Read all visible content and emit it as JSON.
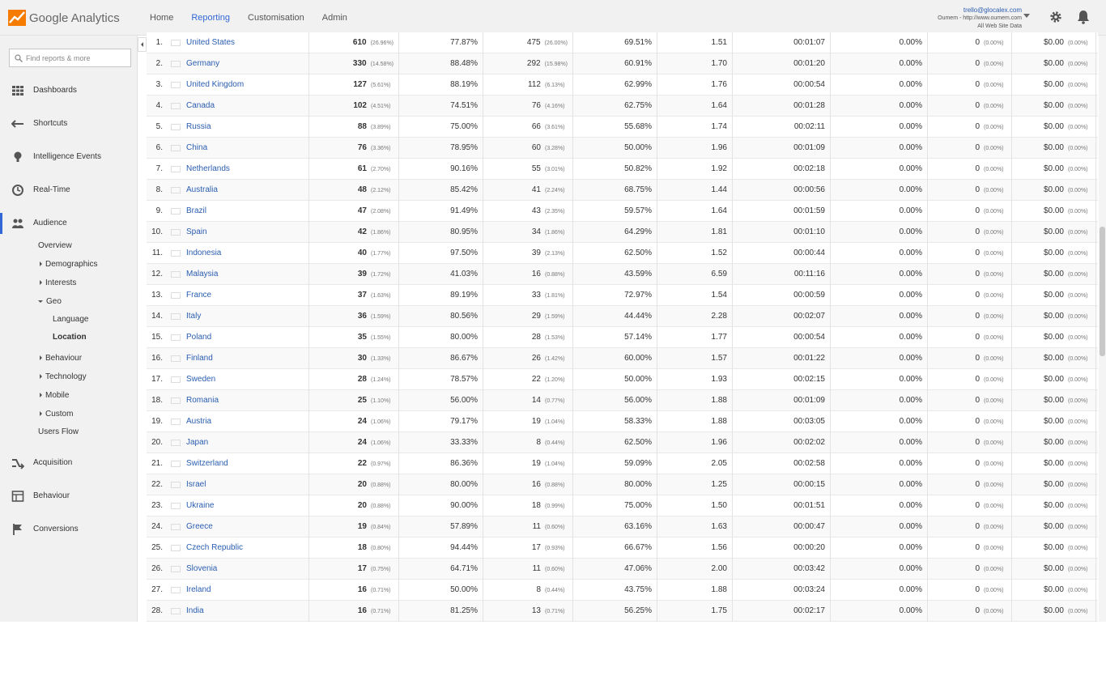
{
  "app": {
    "logo_google": "Google",
    "logo_product": "Analytics"
  },
  "topnav": [
    {
      "label": "Home",
      "active": false
    },
    {
      "label": "Reporting",
      "active": true
    },
    {
      "label": "Customisation",
      "active": false
    },
    {
      "label": "Admin",
      "active": false
    }
  ],
  "account": {
    "email": "trello@glocalex.com",
    "property": "Oumem - http://www.oumem.com",
    "view": "All Web Site Data"
  },
  "sidebar": {
    "search_placeholder": "Find reports & more",
    "main": [
      {
        "label": "Dashboards",
        "icon": "dashboards-icon"
      },
      {
        "label": "Shortcuts",
        "icon": "shortcuts-icon"
      },
      {
        "label": "Intelligence Events",
        "icon": "lightbulb-icon"
      },
      {
        "label": "Real-Time",
        "icon": "clock-icon"
      },
      {
        "label": "Audience",
        "icon": "people-icon",
        "active": true
      },
      {
        "label": "Acquisition",
        "icon": "acquisition-icon"
      },
      {
        "label": "Behaviour",
        "icon": "behaviour-icon"
      },
      {
        "label": "Conversions",
        "icon": "flag-icon"
      }
    ],
    "audience_sub": [
      {
        "label": "Overview",
        "level": 1,
        "caret": "none"
      },
      {
        "label": "Demographics",
        "level": 1,
        "caret": "right"
      },
      {
        "label": "Interests",
        "level": 1,
        "caret": "right"
      },
      {
        "label": "Geo",
        "level": 1,
        "caret": "down"
      },
      {
        "label": "Language",
        "level": 2,
        "caret": "none"
      },
      {
        "label": "Location",
        "level": 2,
        "caret": "none",
        "selected": true
      },
      {
        "label": "Behaviour",
        "level": 1,
        "caret": "right"
      },
      {
        "label": "Technology",
        "level": 1,
        "caret": "right"
      },
      {
        "label": "Mobile",
        "level": 1,
        "caret": "right"
      },
      {
        "label": "Custom",
        "level": 1,
        "caret": "right"
      },
      {
        "label": "Users Flow",
        "level": 1,
        "caret": "none"
      }
    ]
  },
  "table": {
    "rows": [
      {
        "idx": "1.",
        "country": "United States",
        "flag": "us",
        "sessions": "610",
        "sessions_pct": "(26.96%)",
        "new_sessions": "77.87%",
        "new_users": "475",
        "new_users_pct": "(26.00%)",
        "bounce": "69.51%",
        "pages": "1.51",
        "duration": "00:01:07",
        "conv": "0.00%",
        "goal": "0",
        "goal_pct": "(0.00%)",
        "value": "$0.00",
        "value_pct": "(0.00%)"
      },
      {
        "idx": "2.",
        "country": "Germany",
        "flag": "de",
        "sessions": "330",
        "sessions_pct": "(14.58%)",
        "new_sessions": "88.48%",
        "new_users": "292",
        "new_users_pct": "(15.98%)",
        "bounce": "60.91%",
        "pages": "1.70",
        "duration": "00:01:20",
        "conv": "0.00%",
        "goal": "0",
        "goal_pct": "(0.00%)",
        "value": "$0.00",
        "value_pct": "(0.00%)"
      },
      {
        "idx": "3.",
        "country": "United Kingdom",
        "flag": "gb",
        "sessions": "127",
        "sessions_pct": "(5.61%)",
        "new_sessions": "88.19%",
        "new_users": "112",
        "new_users_pct": "(6.13%)",
        "bounce": "62.99%",
        "pages": "1.76",
        "duration": "00:00:54",
        "conv": "0.00%",
        "goal": "0",
        "goal_pct": "(0.00%)",
        "value": "$0.00",
        "value_pct": "(0.00%)"
      },
      {
        "idx": "4.",
        "country": "Canada",
        "flag": "ca",
        "sessions": "102",
        "sessions_pct": "(4.51%)",
        "new_sessions": "74.51%",
        "new_users": "76",
        "new_users_pct": "(4.16%)",
        "bounce": "62.75%",
        "pages": "1.64",
        "duration": "00:01:28",
        "conv": "0.00%",
        "goal": "0",
        "goal_pct": "(0.00%)",
        "value": "$0.00",
        "value_pct": "(0.00%)"
      },
      {
        "idx": "5.",
        "country": "Russia",
        "flag": "ru",
        "sessions": "88",
        "sessions_pct": "(3.89%)",
        "new_sessions": "75.00%",
        "new_users": "66",
        "new_users_pct": "(3.61%)",
        "bounce": "55.68%",
        "pages": "1.74",
        "duration": "00:02:11",
        "conv": "0.00%",
        "goal": "0",
        "goal_pct": "(0.00%)",
        "value": "$0.00",
        "value_pct": "(0.00%)"
      },
      {
        "idx": "6.",
        "country": "China",
        "flag": "cn",
        "sessions": "76",
        "sessions_pct": "(3.36%)",
        "new_sessions": "78.95%",
        "new_users": "60",
        "new_users_pct": "(3.28%)",
        "bounce": "50.00%",
        "pages": "1.96",
        "duration": "00:01:09",
        "conv": "0.00%",
        "goal": "0",
        "goal_pct": "(0.00%)",
        "value": "$0.00",
        "value_pct": "(0.00%)"
      },
      {
        "idx": "7.",
        "country": "Netherlands",
        "flag": "nl",
        "sessions": "61",
        "sessions_pct": "(2.70%)",
        "new_sessions": "90.16%",
        "new_users": "55",
        "new_users_pct": "(3.01%)",
        "bounce": "50.82%",
        "pages": "1.92",
        "duration": "00:02:18",
        "conv": "0.00%",
        "goal": "0",
        "goal_pct": "(0.00%)",
        "value": "$0.00",
        "value_pct": "(0.00%)"
      },
      {
        "idx": "8.",
        "country": "Australia",
        "flag": "au",
        "sessions": "48",
        "sessions_pct": "(2.12%)",
        "new_sessions": "85.42%",
        "new_users": "41",
        "new_users_pct": "(2.24%)",
        "bounce": "68.75%",
        "pages": "1.44",
        "duration": "00:00:56",
        "conv": "0.00%",
        "goal": "0",
        "goal_pct": "(0.00%)",
        "value": "$0.00",
        "value_pct": "(0.00%)"
      },
      {
        "idx": "9.",
        "country": "Brazil",
        "flag": "br",
        "sessions": "47",
        "sessions_pct": "(2.08%)",
        "new_sessions": "91.49%",
        "new_users": "43",
        "new_users_pct": "(2.35%)",
        "bounce": "59.57%",
        "pages": "1.64",
        "duration": "00:01:59",
        "conv": "0.00%",
        "goal": "0",
        "goal_pct": "(0.00%)",
        "value": "$0.00",
        "value_pct": "(0.00%)"
      },
      {
        "idx": "10.",
        "country": "Spain",
        "flag": "es",
        "sessions": "42",
        "sessions_pct": "(1.86%)",
        "new_sessions": "80.95%",
        "new_users": "34",
        "new_users_pct": "(1.86%)",
        "bounce": "64.29%",
        "pages": "1.81",
        "duration": "00:01:10",
        "conv": "0.00%",
        "goal": "0",
        "goal_pct": "(0.00%)",
        "value": "$0.00",
        "value_pct": "(0.00%)"
      },
      {
        "idx": "11.",
        "country": "Indonesia",
        "flag": "id",
        "sessions": "40",
        "sessions_pct": "(1.77%)",
        "new_sessions": "97.50%",
        "new_users": "39",
        "new_users_pct": "(2.13%)",
        "bounce": "62.50%",
        "pages": "1.52",
        "duration": "00:00:44",
        "conv": "0.00%",
        "goal": "0",
        "goal_pct": "(0.00%)",
        "value": "$0.00",
        "value_pct": "(0.00%)"
      },
      {
        "idx": "12.",
        "country": "Malaysia",
        "flag": "my",
        "sessions": "39",
        "sessions_pct": "(1.72%)",
        "new_sessions": "41.03%",
        "new_users": "16",
        "new_users_pct": "(0.88%)",
        "bounce": "43.59%",
        "pages": "6.59",
        "duration": "00:11:16",
        "conv": "0.00%",
        "goal": "0",
        "goal_pct": "(0.00%)",
        "value": "$0.00",
        "value_pct": "(0.00%)"
      },
      {
        "idx": "13.",
        "country": "France",
        "flag": "fr",
        "sessions": "37",
        "sessions_pct": "(1.63%)",
        "new_sessions": "89.19%",
        "new_users": "33",
        "new_users_pct": "(1.81%)",
        "bounce": "72.97%",
        "pages": "1.54",
        "duration": "00:00:59",
        "conv": "0.00%",
        "goal": "0",
        "goal_pct": "(0.00%)",
        "value": "$0.00",
        "value_pct": "(0.00%)"
      },
      {
        "idx": "14.",
        "country": "Italy",
        "flag": "it",
        "sessions": "36",
        "sessions_pct": "(1.59%)",
        "new_sessions": "80.56%",
        "new_users": "29",
        "new_users_pct": "(1.59%)",
        "bounce": "44.44%",
        "pages": "2.28",
        "duration": "00:02:07",
        "conv": "0.00%",
        "goal": "0",
        "goal_pct": "(0.00%)",
        "value": "$0.00",
        "value_pct": "(0.00%)"
      },
      {
        "idx": "15.",
        "country": "Poland",
        "flag": "pl",
        "sessions": "35",
        "sessions_pct": "(1.55%)",
        "new_sessions": "80.00%",
        "new_users": "28",
        "new_users_pct": "(1.53%)",
        "bounce": "57.14%",
        "pages": "1.77",
        "duration": "00:00:54",
        "conv": "0.00%",
        "goal": "0",
        "goal_pct": "(0.00%)",
        "value": "$0.00",
        "value_pct": "(0.00%)"
      },
      {
        "idx": "16.",
        "country": "Finland",
        "flag": "fi",
        "sessions": "30",
        "sessions_pct": "(1.33%)",
        "new_sessions": "86.67%",
        "new_users": "26",
        "new_users_pct": "(1.42%)",
        "bounce": "60.00%",
        "pages": "1.57",
        "duration": "00:01:22",
        "conv": "0.00%",
        "goal": "0",
        "goal_pct": "(0.00%)",
        "value": "$0.00",
        "value_pct": "(0.00%)"
      },
      {
        "idx": "17.",
        "country": "Sweden",
        "flag": "se",
        "sessions": "28",
        "sessions_pct": "(1.24%)",
        "new_sessions": "78.57%",
        "new_users": "22",
        "new_users_pct": "(1.20%)",
        "bounce": "50.00%",
        "pages": "1.93",
        "duration": "00:02:15",
        "conv": "0.00%",
        "goal": "0",
        "goal_pct": "(0.00%)",
        "value": "$0.00",
        "value_pct": "(0.00%)"
      },
      {
        "idx": "18.",
        "country": "Romania",
        "flag": "ro",
        "sessions": "25",
        "sessions_pct": "(1.10%)",
        "new_sessions": "56.00%",
        "new_users": "14",
        "new_users_pct": "(0.77%)",
        "bounce": "56.00%",
        "pages": "1.88",
        "duration": "00:01:09",
        "conv": "0.00%",
        "goal": "0",
        "goal_pct": "(0.00%)",
        "value": "$0.00",
        "value_pct": "(0.00%)"
      },
      {
        "idx": "19.",
        "country": "Austria",
        "flag": "at",
        "sessions": "24",
        "sessions_pct": "(1.06%)",
        "new_sessions": "79.17%",
        "new_users": "19",
        "new_users_pct": "(1.04%)",
        "bounce": "58.33%",
        "pages": "1.88",
        "duration": "00:03:05",
        "conv": "0.00%",
        "goal": "0",
        "goal_pct": "(0.00%)",
        "value": "$0.00",
        "value_pct": "(0.00%)"
      },
      {
        "idx": "20.",
        "country": "Japan",
        "flag": "jp",
        "sessions": "24",
        "sessions_pct": "(1.06%)",
        "new_sessions": "33.33%",
        "new_users": "8",
        "new_users_pct": "(0.44%)",
        "bounce": "62.50%",
        "pages": "1.96",
        "duration": "00:02:02",
        "conv": "0.00%",
        "goal": "0",
        "goal_pct": "(0.00%)",
        "value": "$0.00",
        "value_pct": "(0.00%)"
      },
      {
        "idx": "21.",
        "country": "Switzerland",
        "flag": "ch",
        "sessions": "22",
        "sessions_pct": "(0.97%)",
        "new_sessions": "86.36%",
        "new_users": "19",
        "new_users_pct": "(1.04%)",
        "bounce": "59.09%",
        "pages": "2.05",
        "duration": "00:02:58",
        "conv": "0.00%",
        "goal": "0",
        "goal_pct": "(0.00%)",
        "value": "$0.00",
        "value_pct": "(0.00%)"
      },
      {
        "idx": "22.",
        "country": "Israel",
        "flag": "il",
        "sessions": "20",
        "sessions_pct": "(0.88%)",
        "new_sessions": "80.00%",
        "new_users": "16",
        "new_users_pct": "(0.88%)",
        "bounce": "80.00%",
        "pages": "1.25",
        "duration": "00:00:15",
        "conv": "0.00%",
        "goal": "0",
        "goal_pct": "(0.00%)",
        "value": "$0.00",
        "value_pct": "(0.00%)"
      },
      {
        "idx": "23.",
        "country": "Ukraine",
        "flag": "ua",
        "sessions": "20",
        "sessions_pct": "(0.88%)",
        "new_sessions": "90.00%",
        "new_users": "18",
        "new_users_pct": "(0.99%)",
        "bounce": "75.00%",
        "pages": "1.50",
        "duration": "00:01:51",
        "conv": "0.00%",
        "goal": "0",
        "goal_pct": "(0.00%)",
        "value": "$0.00",
        "value_pct": "(0.00%)"
      },
      {
        "idx": "24.",
        "country": "Greece",
        "flag": "gr",
        "sessions": "19",
        "sessions_pct": "(0.84%)",
        "new_sessions": "57.89%",
        "new_users": "11",
        "new_users_pct": "(0.60%)",
        "bounce": "63.16%",
        "pages": "1.63",
        "duration": "00:00:47",
        "conv": "0.00%",
        "goal": "0",
        "goal_pct": "(0.00%)",
        "value": "$0.00",
        "value_pct": "(0.00%)"
      },
      {
        "idx": "25.",
        "country": "Czech Republic",
        "flag": "cz",
        "sessions": "18",
        "sessions_pct": "(0.80%)",
        "new_sessions": "94.44%",
        "new_users": "17",
        "new_users_pct": "(0.93%)",
        "bounce": "66.67%",
        "pages": "1.56",
        "duration": "00:00:20",
        "conv": "0.00%",
        "goal": "0",
        "goal_pct": "(0.00%)",
        "value": "$0.00",
        "value_pct": "(0.00%)"
      },
      {
        "idx": "26.",
        "country": "Slovenia",
        "flag": "si",
        "sessions": "17",
        "sessions_pct": "(0.75%)",
        "new_sessions": "64.71%",
        "new_users": "11",
        "new_users_pct": "(0.60%)",
        "bounce": "47.06%",
        "pages": "2.00",
        "duration": "00:03:42",
        "conv": "0.00%",
        "goal": "0",
        "goal_pct": "(0.00%)",
        "value": "$0.00",
        "value_pct": "(0.00%)"
      },
      {
        "idx": "27.",
        "country": "Ireland",
        "flag": "ie",
        "sessions": "16",
        "sessions_pct": "(0.71%)",
        "new_sessions": "50.00%",
        "new_users": "8",
        "new_users_pct": "(0.44%)",
        "bounce": "43.75%",
        "pages": "1.88",
        "duration": "00:03:24",
        "conv": "0.00%",
        "goal": "0",
        "goal_pct": "(0.00%)",
        "value": "$0.00",
        "value_pct": "(0.00%)"
      },
      {
        "idx": "28.",
        "country": "India",
        "flag": "in",
        "sessions": "16",
        "sessions_pct": "(0.71%)",
        "new_sessions": "81.25%",
        "new_users": "13",
        "new_users_pct": "(0.71%)",
        "bounce": "56.25%",
        "pages": "1.75",
        "duration": "00:02:17",
        "conv": "0.00%",
        "goal": "0",
        "goal_pct": "(0.00%)",
        "value": "$0.00",
        "value_pct": "(0.00%)"
      }
    ]
  },
  "colors": {
    "accent": "#3367d6",
    "link": "#2a5db0",
    "logo_orange": "#f57c00"
  }
}
